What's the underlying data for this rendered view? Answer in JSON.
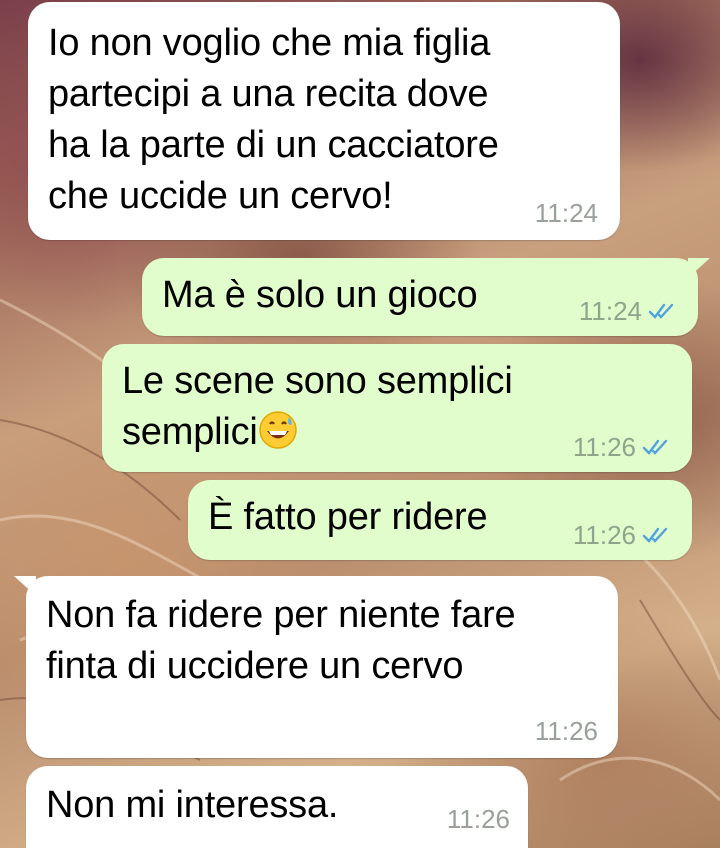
{
  "messages": [
    {
      "text": "Io non voglio che mia figlia\npartecipi a una recita dove\nha la parte di un cacciatore\nche uccide un cervo!",
      "time": "11:24"
    },
    {
      "text": "Ma è solo un gioco",
      "time": "11:24"
    },
    {
      "text_line1": "Le scene sono semplici",
      "text_line2": "semplici",
      "emoji": "grinning-face-with-sweat-emoji",
      "time": "11:26"
    },
    {
      "text": "È fatto per ridere",
      "time": "11:26"
    },
    {
      "text": "Non fa ridere per niente fare\nfinta di uccidere un cervo",
      "time": "11:26"
    },
    {
      "text": "Non mi interessa.",
      "time": "11:26"
    }
  ],
  "colors": {
    "incoming_bubble": "#ffffff",
    "outgoing_bubble": "#e2fdcc",
    "read_ticks": "#4fa3e0",
    "timestamp": "#9aa09a"
  },
  "icons": {
    "read_receipt": "double-check-icon"
  }
}
